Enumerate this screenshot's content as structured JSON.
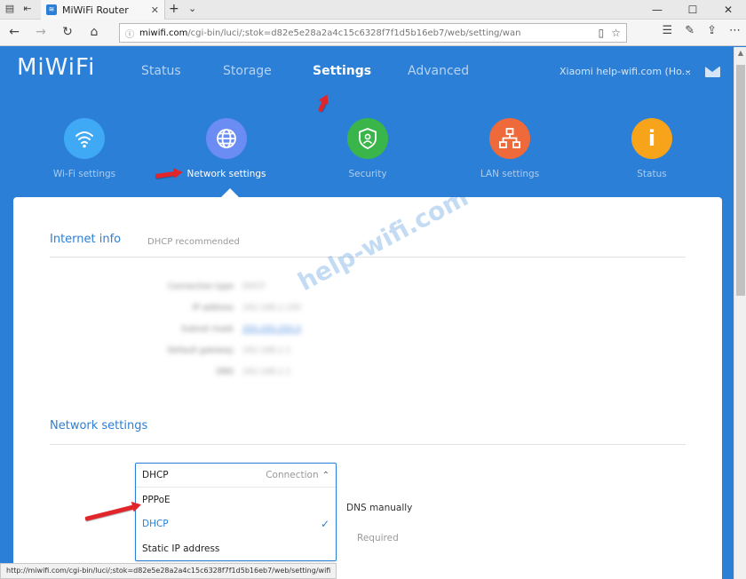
{
  "browser": {
    "tab_title": "MiWiFi Router",
    "url_host": "miwifi.com",
    "url_path": "/cgi-bin/luci/;stok=d82e5e28a2a4c15c6328f7f1d5b16eb7/web/setting/wan",
    "status_url": "http://miwifi.com/cgi-bin/luci/;stok=d82e5e28a2a4c15c6328f7f1d5b16eb7/web/setting/wifi"
  },
  "header": {
    "logo": "MiWiFi",
    "nav": [
      "Status",
      "Storage",
      "Settings",
      "Advanced"
    ],
    "account": "Xiaomi help-wifi.com (Ho..."
  },
  "categories": [
    {
      "label": "Wi-Fi settings",
      "color": "#3fa9f5",
      "icon": "wifi-icon"
    },
    {
      "label": "Network settings",
      "color": "#6b8cf2",
      "icon": "globe-icon"
    },
    {
      "label": "Security",
      "color": "#3ab54a",
      "icon": "shield-icon"
    },
    {
      "label": "LAN settings",
      "color": "#ee6a3a",
      "icon": "network-icon"
    },
    {
      "label": "Status",
      "color": "#f7a41b",
      "icon": "info-icon"
    }
  ],
  "internet_info": {
    "title": "Internet info",
    "note": "DHCP recommended",
    "rows": [
      {
        "key": "Connection type",
        "value": "DHCP"
      },
      {
        "key": "IP address",
        "value": "192.168.1.100"
      },
      {
        "key": "Subnet mask",
        "value": "255.255.255.0"
      },
      {
        "key": "Default gateway",
        "value": "192.168.1.1"
      },
      {
        "key": "DNS",
        "value": "192.168.1.1"
      }
    ]
  },
  "network_settings": {
    "title": "Network settings",
    "dropdown": {
      "value": "DHCP",
      "hint": "Connection",
      "options": [
        "PPPoE",
        "DHCP",
        "Static IP address"
      ],
      "selected": "DHCP"
    },
    "dns_label": "DNS manually",
    "required_label": "Required"
  },
  "watermark": "help-wifi.com",
  "accent_color": "#2b7fd6"
}
